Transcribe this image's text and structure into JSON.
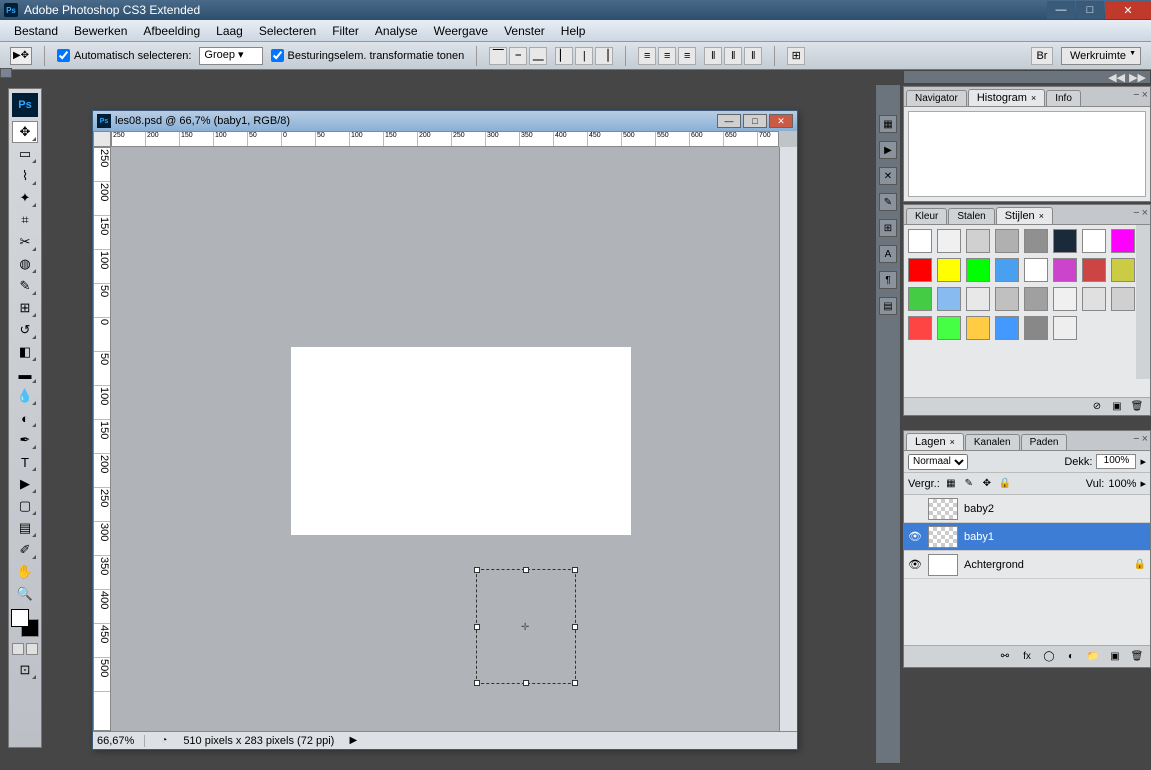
{
  "app": {
    "title": "Adobe Photoshop CS3 Extended",
    "logo": "Ps"
  },
  "menubar": [
    "Bestand",
    "Bewerken",
    "Afbeelding",
    "Laag",
    "Selecteren",
    "Filter",
    "Analyse",
    "Weergave",
    "Venster",
    "Help"
  ],
  "options": {
    "auto_select_label": "Automatisch selecteren:",
    "auto_select_value": "Groep",
    "transform_label": "Besturingselem. transformatie tonen",
    "workspace_label": "Werkruimte"
  },
  "toolbox": {
    "tools": [
      "move",
      "marquee",
      "lasso",
      "wand",
      "crop",
      "slice",
      "healing",
      "brush",
      "stamp",
      "history-brush",
      "eraser",
      "gradient",
      "blur",
      "dodge",
      "pen",
      "type",
      "path-select",
      "shape",
      "notes",
      "eyedropper",
      "hand",
      "zoom"
    ]
  },
  "document": {
    "title": "les08.psd @ 66,7% (baby1, RGB/8)",
    "zoom_status": "66,67%",
    "dims_status": "510 pixels x 283 pixels (72 ppi)",
    "ruler_h": [
      "250",
      "200",
      "150",
      "100",
      "50",
      "0",
      "50",
      "100",
      "150",
      "200",
      "250",
      "300",
      "350",
      "400",
      "450",
      "500",
      "550",
      "600",
      "650",
      "700"
    ],
    "ruler_v": [
      "250",
      "200",
      "150",
      "100",
      "50",
      "0",
      "50",
      "100",
      "150",
      "200",
      "250",
      "300",
      "350",
      "400",
      "450",
      "500"
    ]
  },
  "panel_nav": {
    "tabs": [
      "Navigator",
      "Histogram",
      "Info"
    ],
    "active": 1
  },
  "panel_color": {
    "tabs": [
      "Kleur",
      "Stalen",
      "Stijlen"
    ],
    "active": 2,
    "swatches": [
      "#ffffff",
      "#f0f0f0",
      "#d0d0d0",
      "#b0b0b0",
      "#909090",
      "#1a2a3a",
      "#ffffff",
      "#ff00ff",
      "#ff0000",
      "#ffff00",
      "#00ff00",
      "#4aa0f0",
      "#ffffff",
      "#cc44cc",
      "#cc4444",
      "#cccc44",
      "#44cc44",
      "#88bbf0",
      "#e8e8e8",
      "#c0c0c0",
      "#a0a0a0",
      "#f0f0f0",
      "#e0e0e0",
      "#d0d0d0",
      "#ff4444",
      "#44ff44",
      "#ffcc44",
      "#4499ff",
      "#888888",
      "#eeeeee"
    ]
  },
  "panel_layers": {
    "tabs": [
      "Lagen",
      "Kanalen",
      "Paden"
    ],
    "active": 0,
    "blend_mode": "Normaal",
    "opacity_label": "Dekk:",
    "opacity_value": "100%",
    "fill_label_prefix": "Vergr.:",
    "fill_label": "Vul:",
    "fill_value": "100%",
    "layers": [
      {
        "name": "baby2",
        "visible": false,
        "selected": false,
        "locked": false,
        "thumb": "checker"
      },
      {
        "name": "baby1",
        "visible": true,
        "selected": true,
        "locked": false,
        "thumb": "checker"
      },
      {
        "name": "Achtergrond",
        "visible": true,
        "selected": false,
        "locked": true,
        "thumb": "white"
      }
    ]
  }
}
